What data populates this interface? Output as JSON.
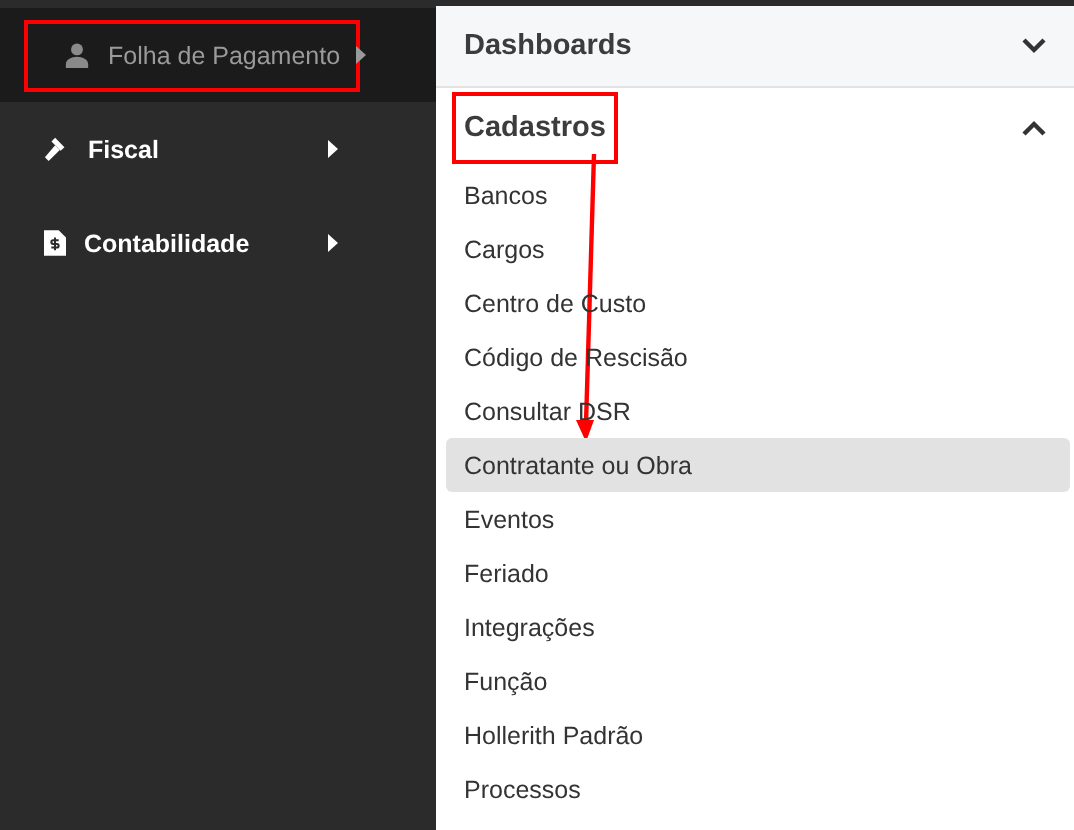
{
  "sidebar": {
    "items": [
      {
        "label": "Folha de Pagamento",
        "selected": true,
        "highlighted": true
      },
      {
        "label": "Fiscal",
        "selected": false,
        "highlighted": false
      },
      {
        "label": "Contabilidade",
        "selected": false,
        "highlighted": false
      }
    ]
  },
  "panel": {
    "sections": [
      {
        "title": "Dashboards",
        "expanded": false,
        "highlighted": false
      },
      {
        "title": "Cadastros",
        "expanded": true,
        "highlighted": true,
        "items": [
          {
            "label": "Bancos",
            "selected": false
          },
          {
            "label": "Cargos",
            "selected": false
          },
          {
            "label": "Centro de Custo",
            "selected": false
          },
          {
            "label": "Código de Rescisão",
            "selected": false
          },
          {
            "label": "Consultar DSR",
            "selected": false
          },
          {
            "label": "Contratante ou Obra",
            "selected": true
          },
          {
            "label": "Eventos",
            "selected": false
          },
          {
            "label": "Feriado",
            "selected": false
          },
          {
            "label": "Integrações",
            "selected": false
          },
          {
            "label": "Função",
            "selected": false
          },
          {
            "label": "Hollerith Padrão",
            "selected": false
          },
          {
            "label": "Processos",
            "selected": false
          }
        ]
      }
    ]
  }
}
